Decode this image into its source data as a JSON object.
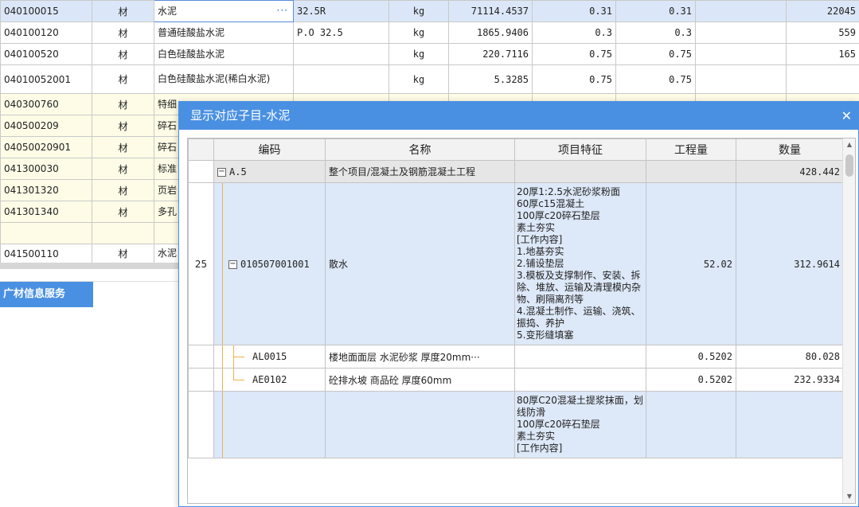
{
  "bg_rows": [
    {
      "code": "040100015",
      "type": "材",
      "name": "水泥",
      "spec": "32.5R",
      "unit": "kg",
      "qty": "71114.4537",
      "p1": "0.31",
      "p2": "0.31",
      "p3": "",
      "amt": "22045",
      "style": "sel"
    },
    {
      "code": "040100120",
      "type": "材",
      "name": "普通硅酸盐水泥",
      "spec": "P.O 32.5",
      "unit": "kg",
      "qty": "1865.9406",
      "p1": "0.3",
      "p2": "0.3",
      "p3": "",
      "amt": "559",
      "style": ""
    },
    {
      "code": "040100520",
      "type": "材",
      "name": "白色硅酸盐水泥",
      "spec": "",
      "unit": "kg",
      "qty": "220.7116",
      "p1": "0.75",
      "p2": "0.75",
      "p3": "",
      "amt": "165",
      "style": ""
    },
    {
      "code": "04010052001",
      "type": "材",
      "name": "白色硅酸盐水泥(稀白水泥)",
      "spec": "",
      "unit": "kg",
      "qty": "5.3285",
      "p1": "0.75",
      "p2": "0.75",
      "p3": "",
      "amt": "",
      "style": "tall"
    },
    {
      "code": "040300760",
      "type": "材",
      "name": "特细",
      "spec": "",
      "unit": "",
      "qty": "",
      "p1": "",
      "p2": "",
      "p3": "",
      "amt": "",
      "style": "yellow"
    },
    {
      "code": "040500209",
      "type": "材",
      "name": "碎石",
      "spec": "",
      "unit": "",
      "qty": "",
      "p1": "",
      "p2": "",
      "p3": "",
      "amt": "",
      "style": "yellow"
    },
    {
      "code": "04050020901",
      "type": "材",
      "name": "碎石",
      "spec": "",
      "unit": "",
      "qty": "",
      "p1": "",
      "p2": "",
      "p3": "",
      "amt": "",
      "style": "yellow"
    },
    {
      "code": "041300030",
      "type": "材",
      "name": "标准",
      "spec": "",
      "unit": "",
      "qty": "",
      "p1": "",
      "p2": "",
      "p3": "",
      "amt": "",
      "style": "yellow"
    },
    {
      "code": "041301320",
      "type": "材",
      "name": "页岩",
      "spec": "",
      "unit": "",
      "qty": "",
      "p1": "",
      "p2": "",
      "p3": "",
      "amt": "",
      "style": "yellow"
    },
    {
      "code": "041301340",
      "type": "材",
      "name": "多孔",
      "spec": "",
      "unit": "",
      "qty": "",
      "p1": "",
      "p2": "",
      "p3": "",
      "amt": "",
      "style": "yellow"
    },
    {
      "code": "",
      "type": "",
      "name": "",
      "spec": "",
      "unit": "",
      "qty": "",
      "p1": "",
      "p2": "",
      "p3": "",
      "amt": "",
      "style": "yellow"
    },
    {
      "code": "041500110",
      "type": "材",
      "name": "水泥",
      "spec": "",
      "unit": "",
      "qty": "",
      "p1": "",
      "p2": "",
      "p3": "",
      "amt": "",
      "style": "partial"
    }
  ],
  "edit_ellipsis": "···",
  "service_tab": "广材信息服务",
  "dialog": {
    "title": "显示对应子目-水泥",
    "close": "✕",
    "headers": [
      "编码",
      "名称",
      "项目特征",
      "工程量",
      "数量"
    ],
    "group": {
      "code": "A.5",
      "name": "整个项目/混凝土及钢筋混凝土工程",
      "qty": "428.442"
    },
    "item": {
      "num": "25",
      "code": "010507001001",
      "name": "散水",
      "features": "20厚1:2.5水泥砂浆粉面\n60厚c15混凝土\n100厚c20碎石垫层\n素土夯实\n[工作内容]\n1.地基夯实\n2.铺设垫层\n3.模板及支撑制作、安装、拆除、堆放、运输及清理模内杂物、刷隔离剂等\n4.混凝土制作、运输、浇筑、振捣、养护\n5.变形缝填塞",
      "workload": "52.02",
      "qty": "312.9614"
    },
    "children": [
      {
        "code": "AL0015",
        "name": "楼地面面层 水泥砂浆 厚度20mm···",
        "workload": "0.5202",
        "qty": "80.028"
      },
      {
        "code": "AE0102",
        "name": "砼排水坡 商品砼 厚度60mm",
        "workload": "0.5202",
        "qty": "232.9334"
      }
    ],
    "next_item": {
      "features": "80厚C20混凝土提浆抹面，划线防滑\n100厚c20碎石垫层\n素土夯实\n[工作内容]"
    },
    "scroll_up": "▲",
    "scroll_down": "▼"
  }
}
